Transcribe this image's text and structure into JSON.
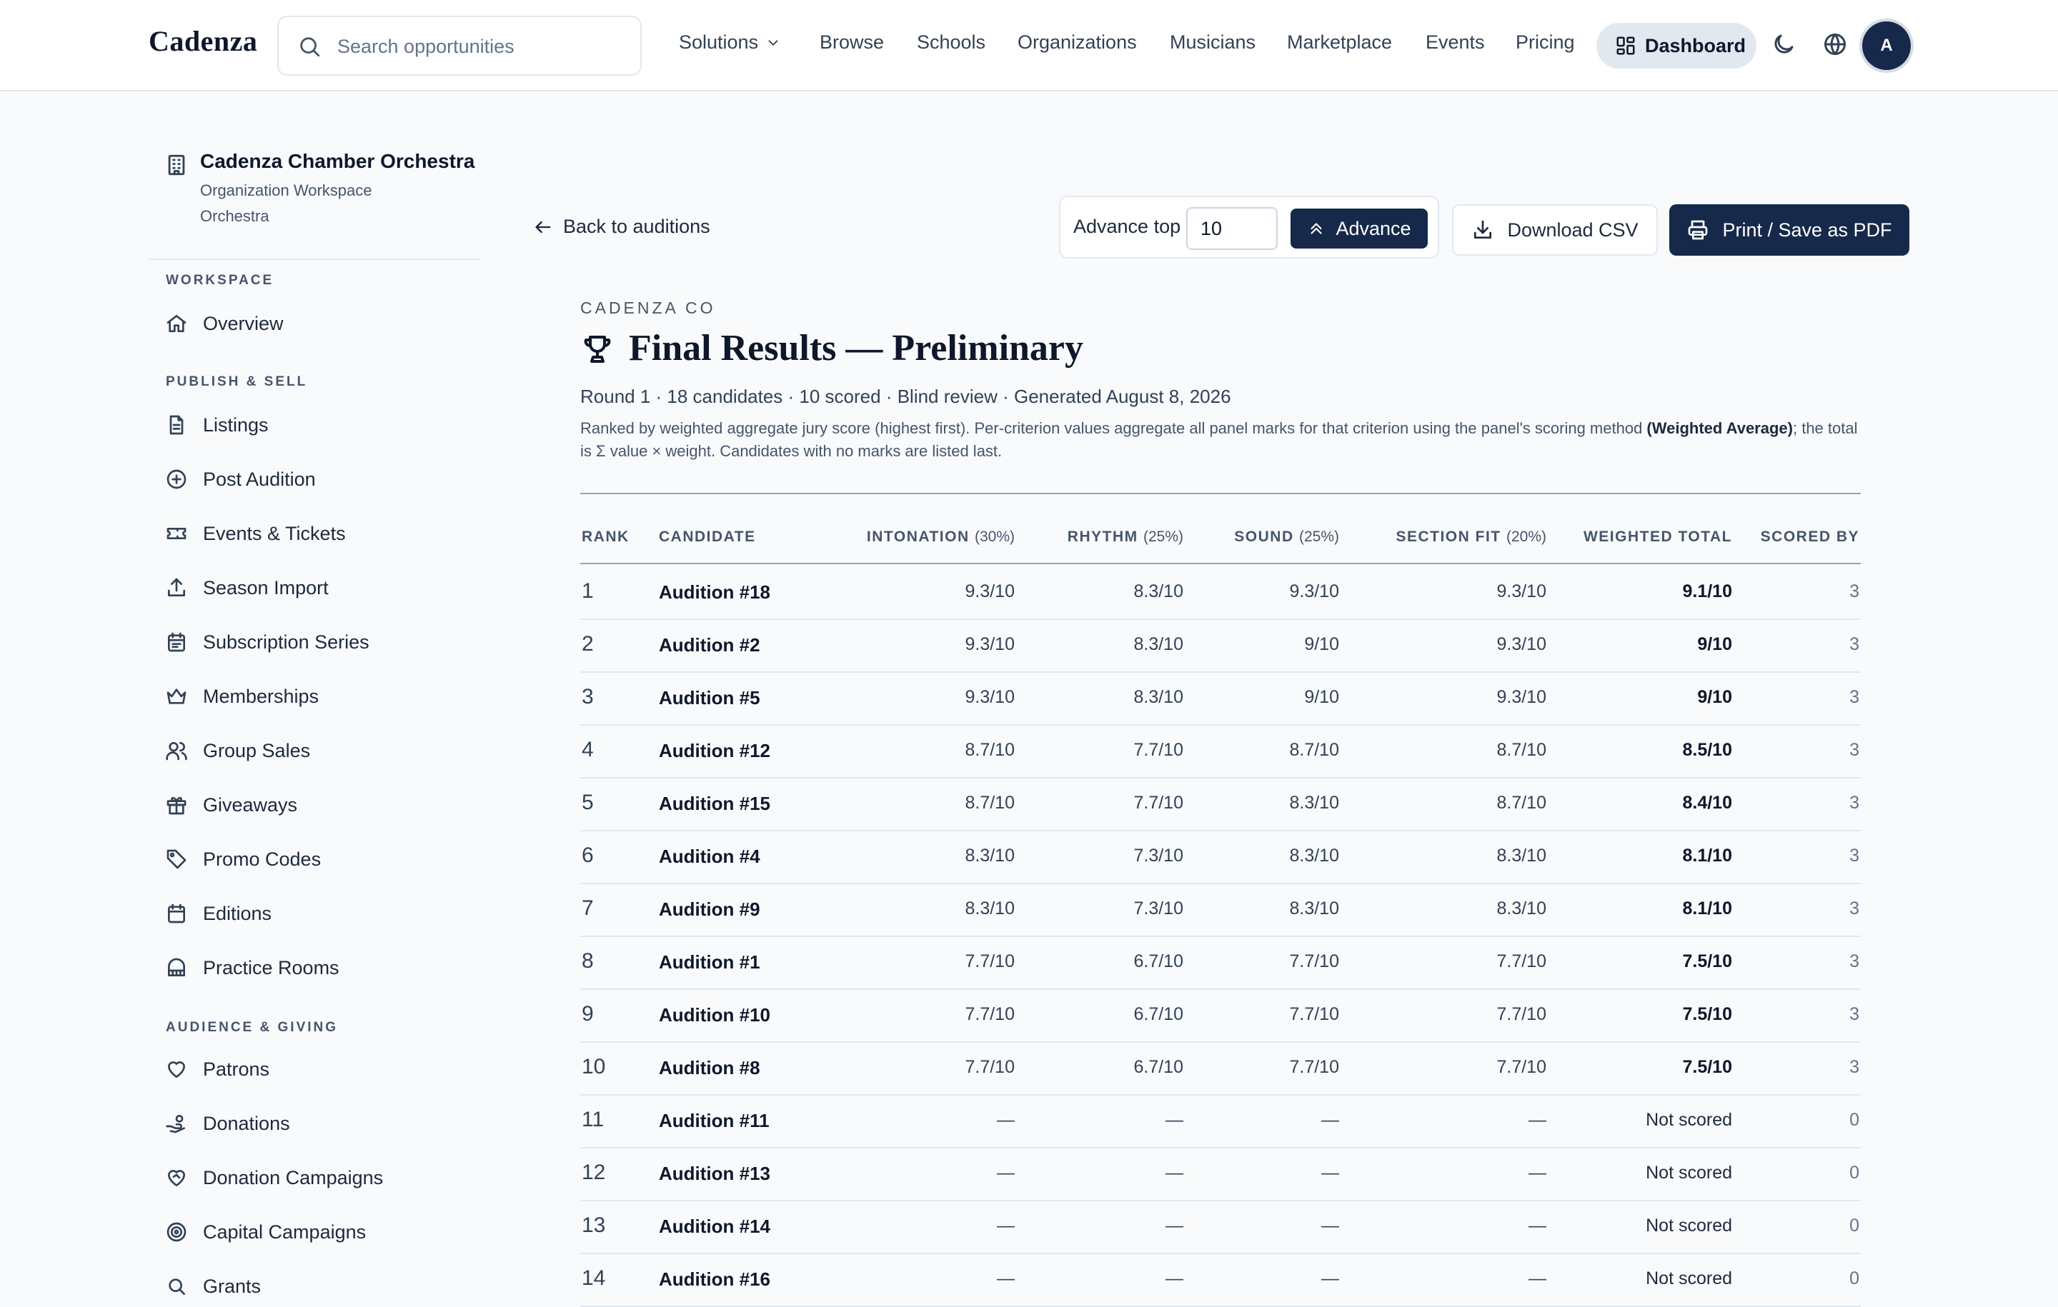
{
  "topnav": {
    "brand": "Cadenza",
    "search_placeholder": "Search opportunities",
    "solutions": "Solutions",
    "links": [
      "Browse",
      "Schools",
      "Organizations",
      "Musicians",
      "Marketplace",
      "Events",
      "Pricing"
    ],
    "dashboard": "Dashboard",
    "avatar_initial": "A"
  },
  "sidebar": {
    "org_name": "Cadenza Chamber Orchestra",
    "org_sub1": "Organization Workspace",
    "org_sub2": "Orchestra",
    "sections": {
      "workspace": "WORKSPACE",
      "publish": "PUBLISH & SELL",
      "audience": "AUDIENCE & GIVING"
    },
    "items": [
      {
        "label": "Overview",
        "icon": "home-icon"
      },
      {
        "label": "Listings",
        "icon": "document-icon"
      },
      {
        "label": "Post Audition",
        "icon": "plus-circle-icon"
      },
      {
        "label": "Events & Tickets",
        "icon": "ticket-icon"
      },
      {
        "label": "Season Import",
        "icon": "upload-icon"
      },
      {
        "label": "Subscription Series",
        "icon": "calendar-list-icon"
      },
      {
        "label": "Memberships",
        "icon": "crown-icon"
      },
      {
        "label": "Group Sales",
        "icon": "users-icon"
      },
      {
        "label": "Giveaways",
        "icon": "gift-icon"
      },
      {
        "label": "Promo Codes",
        "icon": "tag-icon"
      },
      {
        "label": "Editions",
        "icon": "calendar-icon"
      },
      {
        "label": "Practice Rooms",
        "icon": "piano-icon"
      },
      {
        "label": "Patrons",
        "icon": "heart-icon"
      },
      {
        "label": "Donations",
        "icon": "hand-coins-icon"
      },
      {
        "label": "Donation Campaigns",
        "icon": "heart-handshake-icon"
      },
      {
        "label": "Capital Campaigns",
        "icon": "target-icon"
      },
      {
        "label": "Grants",
        "icon": "search-icon"
      }
    ]
  },
  "toolbar": {
    "back": "Back to auditions",
    "advance_label": "Advance top",
    "advance_value": "10",
    "advance_button": "Advance",
    "download_csv": "Download CSV",
    "print_pdf": "Print / Save as PDF"
  },
  "report": {
    "eyebrow": "CADENZA CO",
    "title": "Final Results — Preliminary",
    "meta": "Round 1 · 18 candidates · 10 scored · Blind review · Generated August 8, 2026",
    "desc_before": "Ranked by weighted aggregate jury score (highest first). Per-criterion values aggregate all panel marks for that criterion using the panel's scoring method ",
    "desc_bold": "(Weighted Average)",
    "desc_after": "; the total is Σ value × weight. Candidates with no marks are listed last."
  },
  "table": {
    "headers": {
      "rank": "RANK",
      "candidate": "CANDIDATE",
      "intonation": "INTONATION",
      "intonation_w": "(30%)",
      "rhythm": "RHYTHM",
      "rhythm_w": "(25%)",
      "sound": "SOUND",
      "sound_w": "(25%)",
      "section_fit": "SECTION FIT",
      "section_fit_w": "(20%)",
      "total": "WEIGHTED TOTAL",
      "scored_by": "SCORED BY"
    },
    "rows": [
      {
        "rank": "1",
        "name": "Audition #18",
        "intonation": "9.3/10",
        "rhythm": "8.3/10",
        "sound": "9.3/10",
        "fit": "9.3/10",
        "total": "9.1/10",
        "by": "3"
      },
      {
        "rank": "2",
        "name": "Audition #2",
        "intonation": "9.3/10",
        "rhythm": "8.3/10",
        "sound": "9/10",
        "fit": "9.3/10",
        "total": "9/10",
        "by": "3"
      },
      {
        "rank": "3",
        "name": "Audition #5",
        "intonation": "9.3/10",
        "rhythm": "8.3/10",
        "sound": "9/10",
        "fit": "9.3/10",
        "total": "9/10",
        "by": "3"
      },
      {
        "rank": "4",
        "name": "Audition #12",
        "intonation": "8.7/10",
        "rhythm": "7.7/10",
        "sound": "8.7/10",
        "fit": "8.7/10",
        "total": "8.5/10",
        "by": "3"
      },
      {
        "rank": "5",
        "name": "Audition #15",
        "intonation": "8.7/10",
        "rhythm": "7.7/10",
        "sound": "8.3/10",
        "fit": "8.7/10",
        "total": "8.4/10",
        "by": "3"
      },
      {
        "rank": "6",
        "name": "Audition #4",
        "intonation": "8.3/10",
        "rhythm": "7.3/10",
        "sound": "8.3/10",
        "fit": "8.3/10",
        "total": "8.1/10",
        "by": "3"
      },
      {
        "rank": "7",
        "name": "Audition #9",
        "intonation": "8.3/10",
        "rhythm": "7.3/10",
        "sound": "8.3/10",
        "fit": "8.3/10",
        "total": "8.1/10",
        "by": "3"
      },
      {
        "rank": "8",
        "name": "Audition #1",
        "intonation": "7.7/10",
        "rhythm": "6.7/10",
        "sound": "7.7/10",
        "fit": "7.7/10",
        "total": "7.5/10",
        "by": "3"
      },
      {
        "rank": "9",
        "name": "Audition #10",
        "intonation": "7.7/10",
        "rhythm": "6.7/10",
        "sound": "7.7/10",
        "fit": "7.7/10",
        "total": "7.5/10",
        "by": "3"
      },
      {
        "rank": "10",
        "name": "Audition #8",
        "intonation": "7.7/10",
        "rhythm": "6.7/10",
        "sound": "7.7/10",
        "fit": "7.7/10",
        "total": "7.5/10",
        "by": "3"
      },
      {
        "rank": "11",
        "name": "Audition #11",
        "intonation": "—",
        "rhythm": "—",
        "sound": "—",
        "fit": "—",
        "total": "Not scored",
        "by": "0"
      },
      {
        "rank": "12",
        "name": "Audition #13",
        "intonation": "—",
        "rhythm": "—",
        "sound": "—",
        "fit": "—",
        "total": "Not scored",
        "by": "0"
      },
      {
        "rank": "13",
        "name": "Audition #14",
        "intonation": "—",
        "rhythm": "—",
        "sound": "—",
        "fit": "—",
        "total": "Not scored",
        "by": "0"
      },
      {
        "rank": "14",
        "name": "Audition #16",
        "intonation": "—",
        "rhythm": "—",
        "sound": "—",
        "fit": "—",
        "total": "Not scored",
        "by": "0"
      }
    ]
  },
  "colors": {
    "primary": "#16294a",
    "page_bg": "#f8fafc",
    "border": "#e2e8f0"
  }
}
